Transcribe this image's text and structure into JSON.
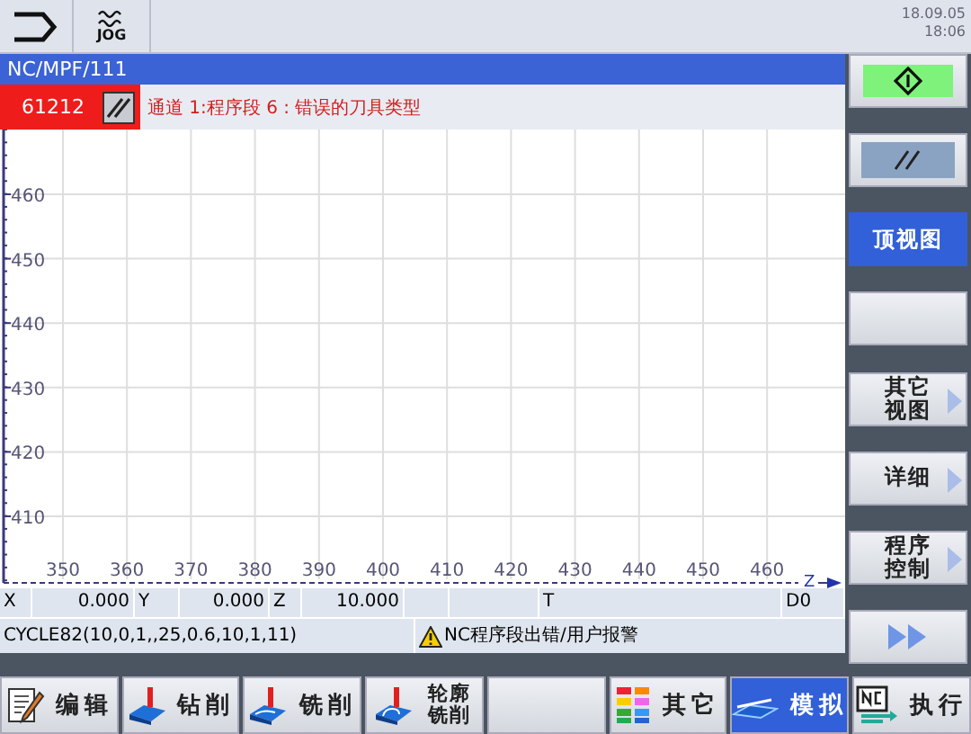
{
  "header": {
    "mode": "JOG",
    "date": "18.09.05",
    "time": "18:06"
  },
  "program_path": "NC/MPF/111",
  "alarm": {
    "number": "61212",
    "message": "通道 1:程序段 6 : 错误的刀具类型"
  },
  "simulation": {
    "y_ticks": [
      "460",
      "450",
      "440",
      "430",
      "420",
      "410"
    ],
    "x_ticks": [
      "350",
      "360",
      "370",
      "380",
      "390",
      "400",
      "410",
      "420",
      "430",
      "440",
      "450",
      "460"
    ],
    "x_axis_label": "Z"
  },
  "positions": [
    {
      "axis": "X",
      "value": "0.000"
    },
    {
      "axis": "Y",
      "value": "0.000"
    },
    {
      "axis": "Z",
      "value": "10.000"
    }
  ],
  "tool": "T",
  "offset": "D0",
  "block": "CYCLE82(10,0,1,,25,0.6,10,1,11)",
  "status_message": "NC程序段出错/用户报警",
  "vertical_softkeys": [
    {
      "kind": "start",
      "selected": false
    },
    {
      "kind": "reset",
      "selected": false
    },
    {
      "kind": "text",
      "label": "顶视图",
      "selected": true
    },
    {
      "kind": "empty",
      "selected": false
    },
    {
      "kind": "menu",
      "label": "其它视图",
      "selected": false
    },
    {
      "kind": "menu",
      "label": "详细",
      "selected": false
    },
    {
      "kind": "menu",
      "label": "程序控制",
      "selected": false
    },
    {
      "kind": "more",
      "selected": false
    }
  ],
  "horizontal_softkeys": [
    {
      "kind": "edit",
      "label": "编辑",
      "selected": false
    },
    {
      "kind": "drill",
      "label": "钻削",
      "selected": false
    },
    {
      "kind": "mill",
      "label": "铣削",
      "selected": false
    },
    {
      "kind": "contour",
      "label": "轮廓铣削",
      "selected": false
    },
    {
      "kind": "empty",
      "selected": false
    },
    {
      "kind": "other",
      "label": "其它",
      "selected": false
    },
    {
      "kind": "simulate",
      "label": "模拟",
      "selected": true
    },
    {
      "kind": "nc",
      "label": "执行",
      "selected": false
    }
  ]
}
